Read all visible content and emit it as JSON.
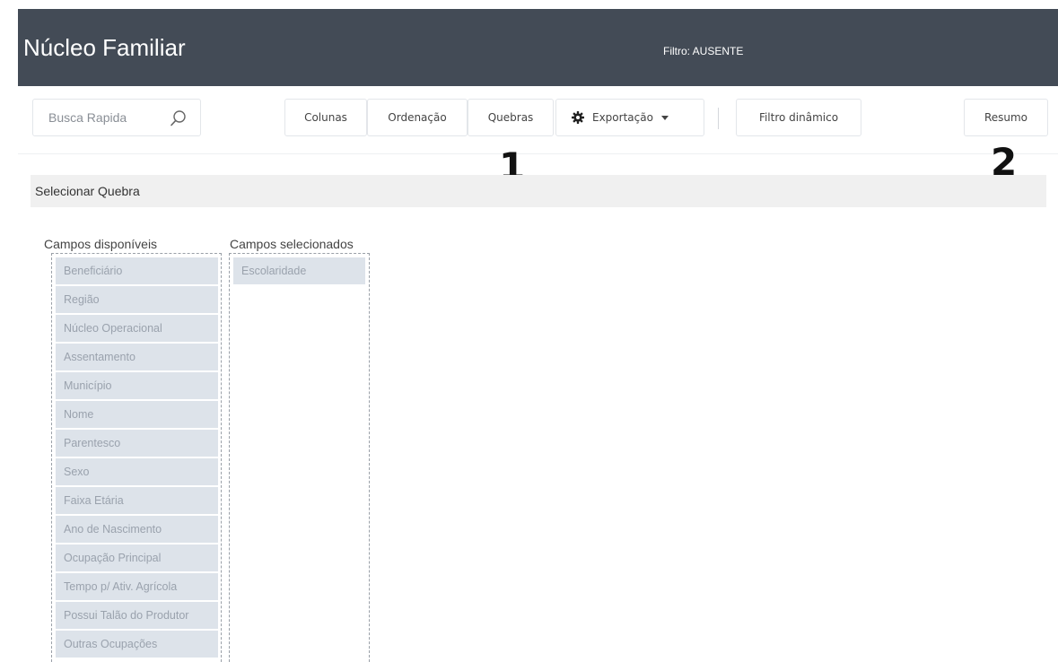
{
  "header": {
    "title": "Núcleo Familiar",
    "filter_label": "Filtro: AUSENTE",
    "background_color": "#434b56"
  },
  "toolbar": {
    "search_placeholder": "Busca Rapida",
    "search_icon": "search-icon",
    "buttons": {
      "colunas": "Colunas",
      "ordenacao": "Ordenação",
      "quebras": "Quebras",
      "exportacao": "Exportação",
      "filtro_dinamico": "Filtro dinâmico",
      "resumo": "Resumo"
    },
    "exportacao_icon": "gear-icon",
    "exportacao_caret_icon": "caret-down-icon"
  },
  "annotations": {
    "marker_1": "1",
    "marker_2": "2"
  },
  "section": {
    "title": "Selecionar Quebra",
    "available_header": "Campos disponíveis",
    "selected_header": "Campos selecionados",
    "available_fields": [
      "Beneficiário",
      "Região",
      "Núcleo Operacional",
      "Assentamento",
      "Município",
      "Nome",
      "Parentesco",
      "Sexo",
      "Faixa Etária",
      "Ano de Nascimento",
      "Ocupação Principal",
      "Tempo p/ Ativ. Agrícola",
      "Possui Talão do Produtor",
      "Outras Ocupações"
    ],
    "selected_fields": [
      "Escolaridade"
    ]
  }
}
